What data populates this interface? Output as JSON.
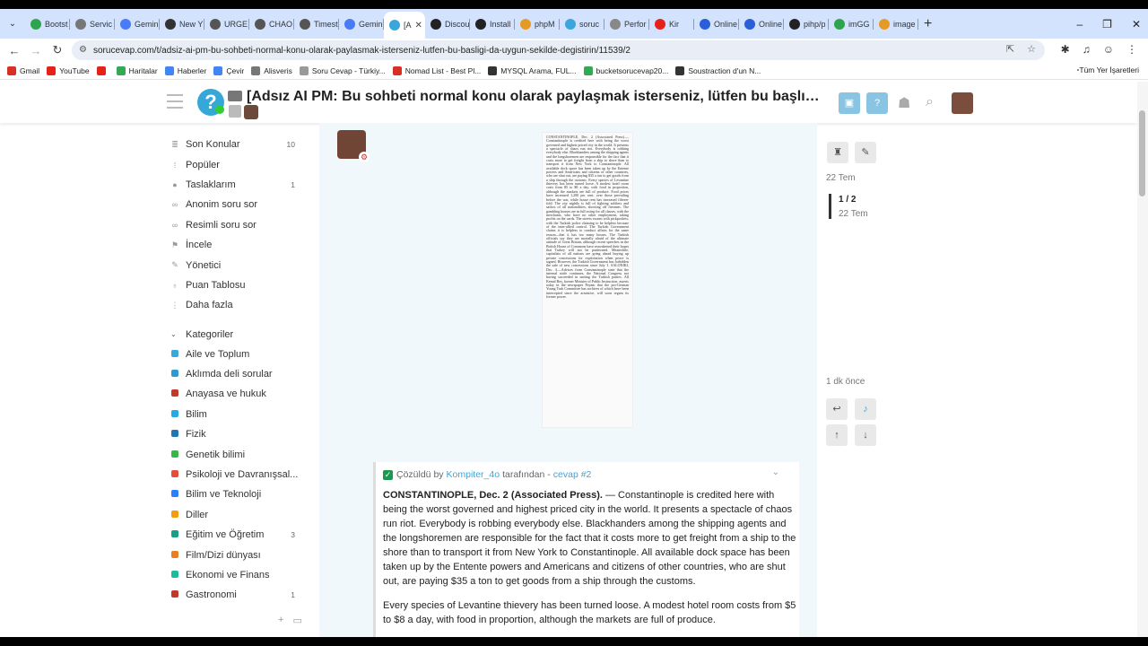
{
  "browser": {
    "tabs": [
      {
        "label": "Bootst",
        "color": "#2da44e"
      },
      {
        "label": "Servic",
        "color": "#777777"
      },
      {
        "label": "Gemin",
        "color": "#4a7bf7"
      },
      {
        "label": "New Y",
        "color": "#333333"
      },
      {
        "label": "URGE",
        "color": "#555555"
      },
      {
        "label": "CHAO",
        "color": "#555555"
      },
      {
        "label": "Timest",
        "color": "#555555"
      },
      {
        "label": "Gemin",
        "color": "#4a7bf7"
      },
      {
        "label": "[A",
        "color": "#3ba6db",
        "active": true
      },
      {
        "label": "Discou",
        "color": "#222222"
      },
      {
        "label": "Install",
        "color": "#222222"
      },
      {
        "label": "phpM",
        "color": "#e49b25"
      },
      {
        "label": "soruc",
        "color": "#3ba6db"
      },
      {
        "label": "Perfor",
        "color": "#888888"
      },
      {
        "label": "Kir",
        "color": "#e62117"
      },
      {
        "label": "Online",
        "color": "#2b5fd9"
      },
      {
        "label": "Online",
        "color": "#2b5fd9"
      },
      {
        "label": "pihp/p",
        "color": "#222222"
      },
      {
        "label": "imGG",
        "color": "#2da44e"
      },
      {
        "label": "image",
        "color": "#e49b25"
      }
    ],
    "url": "sorucevap.com/t/adsiz-ai-pm-bu-sohbeti-normal-konu-olarak-paylasmak-isterseniz-lutfen-bu-basligi-da-uygun-sekilde-degistirin/11539/2",
    "bookmarks": [
      {
        "label": "Gmail",
        "color": "#d93025"
      },
      {
        "label": "YouTube",
        "color": "#e62117"
      },
      {
        "label": "",
        "color": "#e62117"
      },
      {
        "label": "Haritalar",
        "color": "#34a853"
      },
      {
        "label": "Haberler",
        "color": "#4285f4"
      },
      {
        "label": "Çevir",
        "color": "#4285f4"
      },
      {
        "label": "Alisveris",
        "color": "#777777"
      },
      {
        "label": "Soru Cevap - Türkiy...",
        "color": "#999999"
      },
      {
        "label": "Nomad List - Best Pl...",
        "color": "#d93025"
      },
      {
        "label": "MYSQL Arama, FUL...",
        "color": "#333333"
      },
      {
        "label": "bucketsorucevap20...",
        "color": "#34a853"
      },
      {
        "label": "Soustraction d'un N...",
        "color": "#333333"
      }
    ],
    "all_bookmarks": "Tüm Yer İşaretleri"
  },
  "header": {
    "title": "[Adsız AI PM: Bu sohbeti normal konu olarak paylaşmak isterseniz, lütfen bu başlığı da uygun şekilde değiştirin]",
    "logo_glyph": "?"
  },
  "sidebar": {
    "items": [
      {
        "label": "Son Konular",
        "count": "10",
        "icon": "layers-icon",
        "glyph": "≣"
      },
      {
        "label": "Popüler",
        "count": "",
        "icon": "chart-icon",
        "glyph": "⁞"
      },
      {
        "label": "Taslaklarım",
        "count": "1",
        "icon": "user-icon",
        "glyph": "●"
      },
      {
        "label": "Anonim soru sor",
        "count": "",
        "icon": "link-icon",
        "glyph": "∞"
      },
      {
        "label": "Resimli soru sor",
        "count": "",
        "icon": "link-icon",
        "glyph": "∞"
      },
      {
        "label": "İncele",
        "count": "",
        "icon": "flag-icon",
        "glyph": "⚑"
      },
      {
        "label": "Yönetici",
        "count": "",
        "icon": "wrench-icon",
        "glyph": "✎"
      },
      {
        "label": "Puan Tablosu",
        "count": "",
        "icon": "medal-icon",
        "glyph": "♁"
      },
      {
        "label": "Daha fazla",
        "count": "",
        "icon": "more-icon",
        "glyph": "⋮"
      }
    ],
    "categories_label": "Kategoriler",
    "categories": [
      {
        "label": "Aile ve Toplum",
        "count": "",
        "color": "#3ba6db"
      },
      {
        "label": "Aklımda deli sorular",
        "count": "",
        "color": "#2e9ad0"
      },
      {
        "label": "Anayasa ve hukuk",
        "count": "",
        "color": "#c0392b"
      },
      {
        "label": "Bilim",
        "count": "",
        "color": "#25aae1"
      },
      {
        "label": "Fizik",
        "count": "",
        "color": "#1f78b4"
      },
      {
        "label": "Genetik bilimi",
        "count": "",
        "color": "#3ab54a"
      },
      {
        "label": "Psikoloji ve Davranışsal...",
        "count": "",
        "color": "#e74c3c"
      },
      {
        "label": "Bilim ve Teknoloji",
        "count": "",
        "color": "#2a7fff"
      },
      {
        "label": "Diller",
        "count": "",
        "color": "#f39c12"
      },
      {
        "label": "Eğitim ve Öğretim",
        "count": "3",
        "color": "#16a085"
      },
      {
        "label": "Film/Dizi dünyası",
        "count": "",
        "color": "#e67e22"
      },
      {
        "label": "Ekonomi ve Finans",
        "count": "",
        "color": "#1abc9c"
      },
      {
        "label": "Gastronomi",
        "count": "1",
        "color": "#c0392b"
      }
    ]
  },
  "clipping": {
    "text": "CONSTANTINOPLE, Dec. 2 (Associated Press).—Constantinople is credited here with being the worst governed and highest priced city in the world. It presents a spectacle of chaos run riot. Everybody is robbing everybody else. Blackhanders among the shipping agents and the longshoremen are responsible for the fact that it costs more to get freight from a ship to shore than to transport it from New York to Constantinople. All available dock space has been taken up by the Entente powers and Americans and citizens of other countries, who are shut out, are paying $35 a ton to get goods from a ship through the customs. Every species of Levantine thievery has been turned loose. A modest hotel room costs from $5 to $8 a day, with food in proportion, although the markets are full of produce. Food prices have increased 1,200 per cent. over those prevailing before the war, while house rent has increased fifteen-fold. The city nightly is full of fighting soldiers and sailors of all nationalities, shooting off firearms. The gambling houses are in full swing for all classes, with the merchants, who have no other employment, taking profits on the cards. The streets swarm with pickpockets, with the Turkish police claiming to be helpless because of the inter-allied control. The Turkish Government claims it is helpless to conduct affairs for the same reason—that it has too many bosses. The Turkish officials say they are mortally afraid of the ultimate attitude of Great Britain, although recent speeches in the British House of Commons have reawakened their hopes that Turkey will not be partitioned. Meanwhile, capitalists of all nations are going ahead buying up private concessions for exploitation when peace is signed. However, the Turkish Government has forbidden the sale of new concessions since July 1. SALONIKI, Dec. 4.—Advices from Constantinople state that the internal strife continues, the National Congress not having succeeded in uniting the Turkish parties. All Kemal Bey, former Minister of Public Instruction, asserts today in the newspaper Peyam that the pro-German Young Turk Committee has archives of which have been intercepted since the armistice, will soon regain its former power."
  },
  "solution": {
    "prefix": "Çözüldü by",
    "author": "Kompiter_4o",
    "middle": "tarafından -",
    "link": "cevap #2",
    "para1_bold": "CONSTANTINOPLE, Dec. 2 (Associated Press).",
    "para1_rest": " — Constantinople is credited here with being the worst governed and highest priced city in the world. It presents a spectacle of chaos run riot. Everybody is robbing everybody else. Blackhanders among the shipping agents and the longshoremen are responsible for the fact that it costs more to get freight from a ship to the shore than to transport it from New York to Constantinople. All available dock space has been taken up by the Entente powers and Americans and citizens of other countries, who are shut out, are paying $35 a ton to get goods from a ship through the customs.",
    "para2": "Every species of Levantine thievery has been turned loose. A modest hotel room costs from $5 to $8 a day, with food in proportion, although the markets are full of produce."
  },
  "timeline": {
    "start_date": "22 Tem",
    "position": "1 / 2",
    "position_date": "22 Tem",
    "last": "1 dk önce"
  }
}
